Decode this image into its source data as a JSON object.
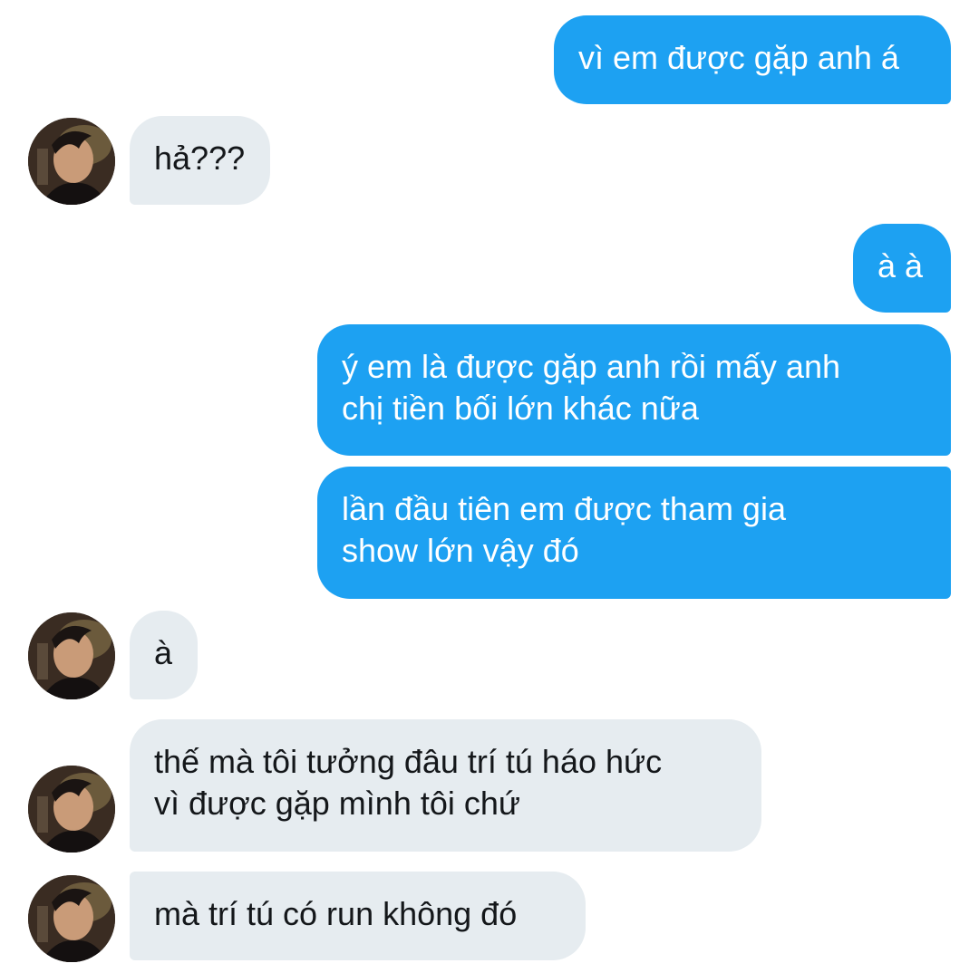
{
  "messages": [
    {
      "from": "me",
      "lines": [
        "vì em được gặp anh á"
      ]
    },
    {
      "from": "them",
      "lines": [
        "hả???"
      ]
    },
    {
      "from": "me",
      "lines": [
        "à à"
      ]
    },
    {
      "from": "me",
      "lines": [
        "ý em là được gặp anh rồi mấy anh",
        "chị tiền bối lớn khác nữa"
      ]
    },
    {
      "from": "me",
      "lines": [
        "lần đầu tiên em được tham gia",
        "show lớn vậy đó"
      ]
    },
    {
      "from": "them",
      "lines": [
        "à"
      ]
    },
    {
      "from": "them",
      "lines": [
        "thế mà tôi tưởng đâu trí tú háo hức",
        "vì được gặp mình tôi chứ"
      ]
    },
    {
      "from": "them",
      "lines": [
        "mà trí tú có run không đó"
      ]
    }
  ],
  "colors": {
    "sent_bubble": "#1da1f2",
    "received_bubble": "#e6ecf0",
    "sent_text": "#ffffff",
    "received_text": "#14171a"
  },
  "avatar": {
    "icon": "profile-photo-avatar"
  }
}
